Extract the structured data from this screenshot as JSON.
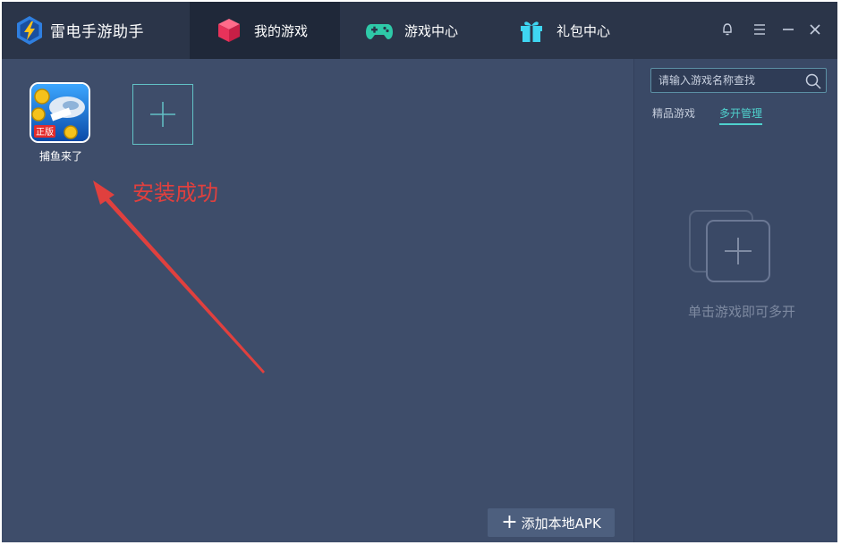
{
  "app": {
    "title": "雷电手游助手"
  },
  "tabs": [
    {
      "label": "我的游戏",
      "icon": "cube-icon",
      "active": true
    },
    {
      "label": "游戏中心",
      "icon": "gamepad-icon",
      "active": false
    },
    {
      "label": "礼包中心",
      "icon": "gift-icon",
      "active": false
    }
  ],
  "window_controls": [
    "skin-icon",
    "menu-icon",
    "minimize-icon",
    "close-icon"
  ],
  "main": {
    "games": [
      {
        "name": "捕鱼来了",
        "badge": "正版",
        "icon": "fishing-game-icon"
      }
    ],
    "annotation": "安装成功",
    "add_apk_label": "添加本地APK"
  },
  "side": {
    "search_placeholder": "请输入游戏名称查找",
    "tabs": [
      {
        "label": "精品游戏",
        "active": false
      },
      {
        "label": "多开管理",
        "active": true
      }
    ],
    "hint": "单击游戏即可多开"
  },
  "colors": {
    "window_bg": "#3e4d6a",
    "titlebar_bg": "#2b3549",
    "active_tab_bg": "#1f2839",
    "accent": "#4fd1cd",
    "annotation": "#e0403e"
  }
}
